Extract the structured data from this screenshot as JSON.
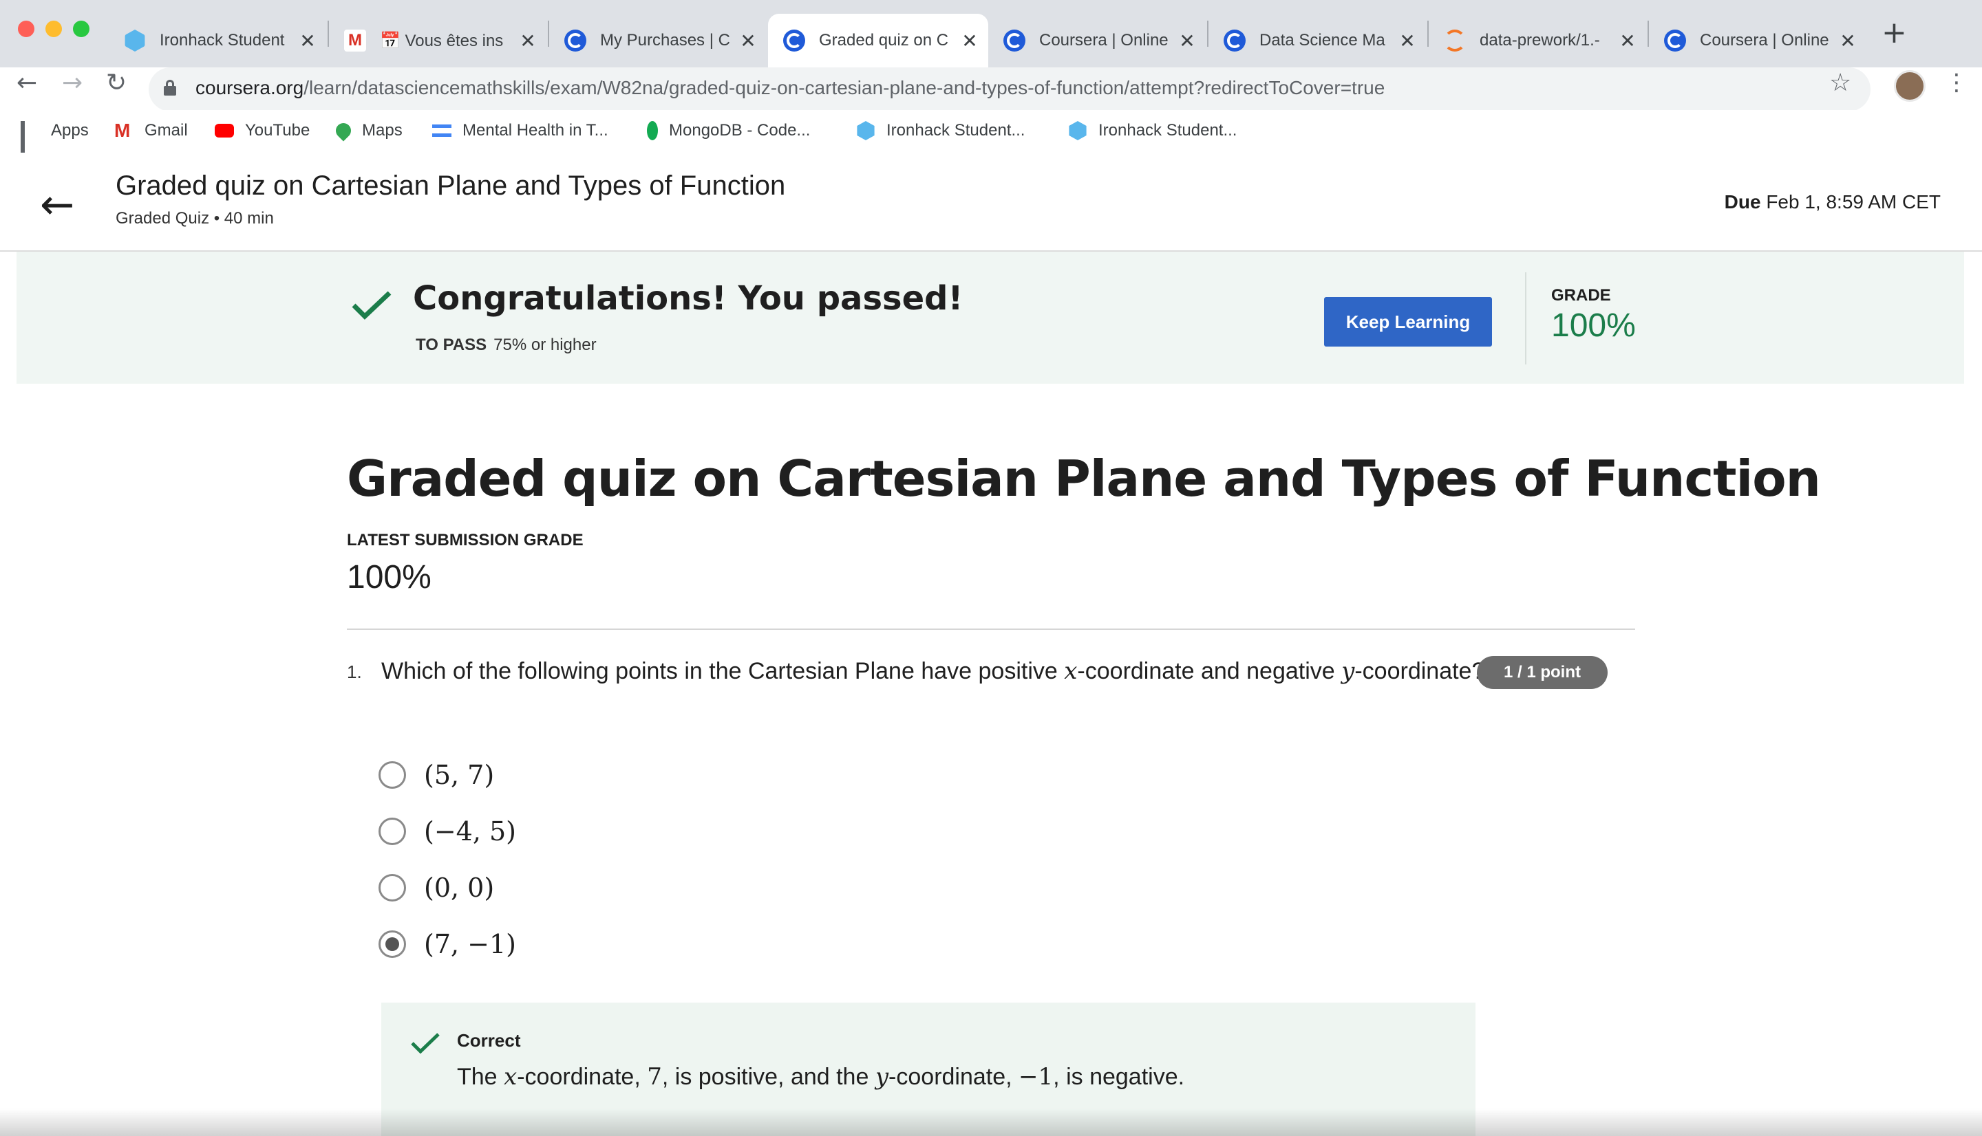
{
  "browser": {
    "tabs": [
      {
        "title": "Ironhack Student",
        "favicon": "ironhack-icon"
      },
      {
        "title": "📅 Vous êtes ins",
        "favicon": "gmail-icon"
      },
      {
        "title": "My Purchases | C",
        "favicon": "coursera-icon"
      },
      {
        "title": "Graded quiz on C",
        "favicon": "coursera-icon",
        "active": true
      },
      {
        "title": "Coursera | Online",
        "favicon": "coursera-icon"
      },
      {
        "title": "Data Science Ma",
        "favicon": "coursera-icon"
      },
      {
        "title": "data-prework/1.-",
        "favicon": "jupyter-icon"
      },
      {
        "title": "Coursera | Online",
        "favicon": "coursera-icon"
      }
    ],
    "url_host": "coursera.org",
    "url_path": "/learn/datasciencemathskills/exam/W82na/graded-quiz-on-cartesian-plane-and-types-of-function/attempt?redirectToCover=true",
    "bookmarks": [
      {
        "label": "Apps",
        "icon": "apps-grid-icon"
      },
      {
        "label": "Gmail",
        "icon": "gmail-icon"
      },
      {
        "label": "YouTube",
        "icon": "youtube-icon"
      },
      {
        "label": "Maps",
        "icon": "maps-pin-icon"
      },
      {
        "label": "Mental Health in T...",
        "icon": "mental-health-icon"
      },
      {
        "label": "MongoDB - Code...",
        "icon": "mongodb-leaf-icon"
      },
      {
        "label": "Ironhack Student...",
        "icon": "ironhack-icon"
      },
      {
        "label": "Ironhack Student...",
        "icon": "ironhack-icon"
      }
    ]
  },
  "header": {
    "title": "Graded quiz on Cartesian Plane and Types of Function",
    "subtitle": "Graded Quiz • 40 min",
    "due_label": "Due",
    "due_value": "Feb 1, 8:59 AM CET"
  },
  "banner": {
    "title": "Congratulations! You passed!",
    "to_pass_label": "TO PASS",
    "to_pass_value": "75% or higher",
    "button_label": "Keep Learning",
    "grade_label": "GRADE",
    "grade_value": "100%",
    "accent_color": "#1b7d4a"
  },
  "main": {
    "title": "Graded quiz on Cartesian Plane and Types of Function",
    "latest_grade_label": "LATEST SUBMISSION GRADE",
    "latest_grade_value": "100%",
    "question": {
      "number": "1.",
      "text_pre": "Which of the following points in the Cartesian Plane have positive ",
      "var_x": "x",
      "text_mid": "-coordinate and negative ",
      "var_y": "y",
      "text_post": "-coordinate?",
      "points": "1 / 1 point",
      "options": [
        "(5, 7)",
        "(−4, 5)",
        "(0, 0)",
        "(7, −1)"
      ],
      "selected_index": 3,
      "feedback": {
        "title": "Correct",
        "t1": "The ",
        "v1": "x",
        "t2": "-coordinate, ",
        "n1": "7",
        "t3": ", is positive, and the ",
        "v2": "y",
        "t4": "-coordinate, ",
        "n2": "−1",
        "t5": ", is negative."
      }
    }
  }
}
